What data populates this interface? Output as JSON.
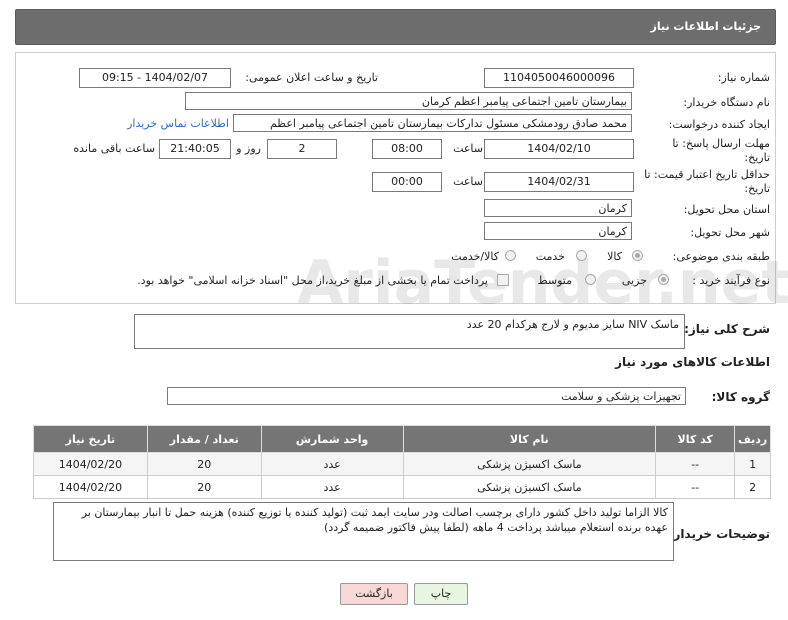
{
  "header": {
    "title": "جزئیات اطلاعات نیاز"
  },
  "form": {
    "need_number_label": "شماره نیاز:",
    "need_number": "1104050046000096",
    "announce_label": "تاریخ و ساعت اعلان عمومی:",
    "announce_value": "1404/02/07 - 09:15",
    "buyer_org_label": "نام دستگاه خریدار:",
    "buyer_org": "بیمارستان تامین اجتماعی پیامبر اعظم کرمان",
    "requester_label": "ایجاد کننده درخواست:",
    "requester": "محمد صادق  رودمشکی مسئول تدارکات بیمارستان تامین اجتماعی پیامبر اعظم",
    "contact_link": "اطلاعات تماس خریدار",
    "deadline_label": "مهلت ارسال پاسخ: تا تاریخ:",
    "deadline_date": "1404/02/10",
    "time_label": "ساعت",
    "deadline_time": "08:00",
    "days_value": "2",
    "days_label": "روز و",
    "remaining_time": "21:40:05",
    "remaining_label": "ساعت باقی مانده",
    "validity_label": "حداقل تاریخ اعتبار قیمت: تا تاریخ:",
    "validity_date": "1404/02/31",
    "validity_time": "00:00",
    "province_label": "استان محل تحویل:",
    "province": "کرمان",
    "city_label": "شهر محل تحویل:",
    "city": "کرمان",
    "category_label": "طبقه بندی موضوعی:",
    "category_options": [
      "کالا",
      "خدمت",
      "کالا/خدمت"
    ],
    "process_label": "نوع فرآیند خرید :",
    "process_options": [
      "جزیی",
      "متوسط"
    ],
    "payment_note": "پرداخت تمام یا بخشی از مبلغ خرید،از محل \"اسناد خزانه اسلامی\" خواهد بود."
  },
  "summary": {
    "label": "شرح کلی نیاز:",
    "value": "ماسک NIV سایز مدیوم و لارج هرکدام 20 عدد"
  },
  "goods_section_title": "اطلاعات کالاهای مورد نیاز",
  "goods_group": {
    "label": "گروه کالا:",
    "value": "تجهیزات پزشکی و سلامت"
  },
  "table": {
    "headers": [
      "ردیف",
      "کد کالا",
      "نام کالا",
      "واحد شمارش",
      "تعداد / مقدار",
      "تاریخ نیاز"
    ],
    "rows": [
      [
        "1",
        "--",
        "ماسک اکسیژن پزشکی",
        "عدد",
        "20",
        "1404/02/20"
      ],
      [
        "2",
        "--",
        "ماسک اکسیژن پزشکی",
        "عدد",
        "20",
        "1404/02/20"
      ]
    ]
  },
  "buyer_notes": {
    "label": "توضیحات خریدار:",
    "value": "کالا الزاما تولید داخل کشور دارای برچسب اصالت ودر سایت ایمد ثبت (تولید کننده یا توزیع کننده) هزینه حمل تا انبار بیمارستان بر عهده برنده استعلام میباشد پرداخت 4 ماهه (لطفا پیش فاکتور ضمیمه گردد)"
  },
  "buttons": {
    "print": "چاپ",
    "back": "بازگشت"
  },
  "watermark": "AriaTender.net",
  "colors": {
    "header_bg": "#6d6d6d",
    "link": "#2a6cc4",
    "back_btn": "#f8d7d7",
    "print_btn": "#e8f5e0"
  }
}
